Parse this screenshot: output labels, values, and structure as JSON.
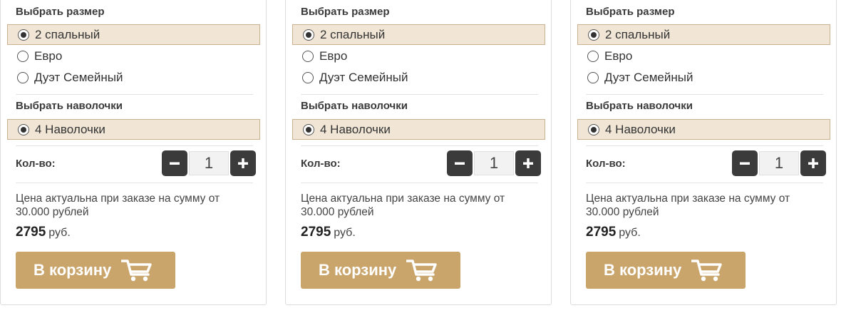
{
  "cards": [
    {
      "size_title": "Выбрать размер",
      "size_options": [
        {
          "label": "2 спальный",
          "selected": true
        },
        {
          "label": "Евро",
          "selected": false
        },
        {
          "label": "Дуэт Семейный",
          "selected": false
        }
      ],
      "pillow_title": "Выбрать наволочки",
      "pillow_options": [
        {
          "label": "4 Наволочки",
          "selected": true
        }
      ],
      "qty_label": "Кол-во:",
      "qty_value": "1",
      "note": "Цена актуальна при заказе на сумму от 30.000 рублей",
      "price_value": "2795",
      "price_currency": "руб.",
      "cart_label": "В корзину"
    },
    {
      "size_title": "Выбрать размер",
      "size_options": [
        {
          "label": "2 спальный",
          "selected": true
        },
        {
          "label": "Евро",
          "selected": false
        },
        {
          "label": "Дуэт Семейный",
          "selected": false
        }
      ],
      "pillow_title": "Выбрать наволочки",
      "pillow_options": [
        {
          "label": "4 Наволочки",
          "selected": true
        }
      ],
      "qty_label": "Кол-во:",
      "qty_value": "1",
      "note": "Цена актуальна при заказе на сумму от 30.000 рублей",
      "price_value": "2795",
      "price_currency": "руб.",
      "cart_label": "В корзину"
    },
    {
      "size_title": "Выбрать размер",
      "size_options": [
        {
          "label": "2 спальный",
          "selected": true
        },
        {
          "label": "Евро",
          "selected": false
        },
        {
          "label": "Дуэт Семейный",
          "selected": false
        }
      ],
      "pillow_title": "Выбрать наволочки",
      "pillow_options": [
        {
          "label": "4 Наволочки",
          "selected": true
        }
      ],
      "qty_label": "Кол-во:",
      "qty_value": "1",
      "note": "Цена актуальна при заказе на сумму от 30.000 рублей",
      "price_value": "2795",
      "price_currency": "руб.",
      "cart_label": "В корзину"
    }
  ],
  "icons": {
    "minus": "minus-icon",
    "plus": "plus-icon",
    "cart": "shopping-cart-icon"
  },
  "colors": {
    "selected_bg": "#f1e6d6",
    "selected_border": "#c9b08e",
    "cart_button": "#c9a46b",
    "qty_button": "#3b3b3b"
  }
}
